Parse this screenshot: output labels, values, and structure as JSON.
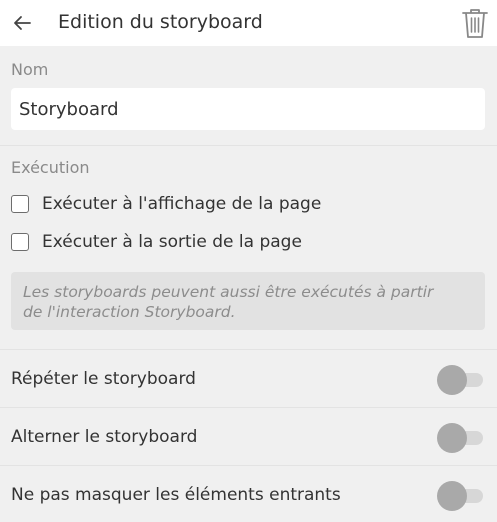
{
  "header": {
    "title": "Edition du storyboard",
    "back_icon": "arrow-left-icon",
    "delete_icon": "trash-icon"
  },
  "name_section": {
    "label": "Nom",
    "input_value": "Storyboard"
  },
  "execution_section": {
    "label": "Exécution",
    "options": [
      {
        "label": "Exécuter à l'affichage de la page",
        "checked": false
      },
      {
        "label": "Exécuter à la sortie de la page",
        "checked": false
      }
    ],
    "info_line1": "Les storyboards peuvent aussi être exécutés à partir",
    "info_line2": "de l'interaction Storyboard."
  },
  "toggles": [
    {
      "label": "Répéter le storyboard",
      "on": false
    },
    {
      "label": "Alterner le storyboard",
      "on": false
    },
    {
      "label": "Ne pas masquer les éléments entrants",
      "on": false
    }
  ],
  "colors": {
    "background": "#f0f0f0",
    "panel": "#ffffff",
    "muted_text": "#8a8a8a",
    "toggle_knob_off": "#a9a9a9",
    "toggle_track_off": "#d7d7d7"
  }
}
